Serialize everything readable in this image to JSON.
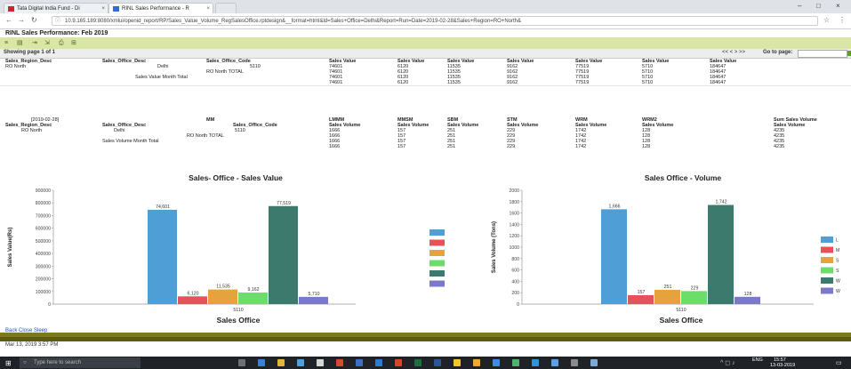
{
  "browser": {
    "tabs": [
      {
        "label": "Tata Digital India Fund - Di"
      },
      {
        "label": "RINL Sales Performance - R"
      }
    ],
    "url": "10.9.165.189:8080/xmlui/openid_report/RP/Sales_Value_Volume_RegSalesOffice.rptdesign&__format=html&ld=Sales+Office=Delhi&Report=Run=Date=2019-02-28&Sales+Region=RO+North&"
  },
  "report": {
    "title": "RINL Sales Performance: Feb 2019",
    "pager": {
      "showing": "Showing page 1 of 1",
      "nav": "<< < > >>",
      "goto": "Go to page:"
    },
    "value_section": {
      "headers": [
        "Sales_Region_Desc",
        "Sales_Office_Desc",
        "Sales_Office_Code",
        "Sales Value",
        "Sales Value",
        "Sales Value",
        "Sales Value",
        "Sales Value",
        "Sales Value",
        "Sales Value"
      ],
      "region": "RO North",
      "office": "Delhi",
      "code": "5110",
      "values": [
        "74601",
        "6120",
        "11535",
        "9162",
        "77519",
        "5710",
        "184647"
      ],
      "total_label": "RO North TOTAL",
      "month_total_label": "Sales Value Month Total"
    },
    "volume_section": {
      "period": "[2019-02-28]",
      "headers_top": [
        "",
        "",
        "MM",
        "",
        "LMMM",
        "MMSM",
        "SBM",
        "STM",
        "WRM",
        "WRM2",
        "Sum Sales Volume"
      ],
      "headers": [
        "Sales_Region_Desc",
        "Sales_Office_Desc",
        "",
        "Sales_Office_Code",
        "Sales Volume",
        "Sales Volume",
        "Sales Volume",
        "Sales Volume",
        "Sales Volume",
        "Sales Volume",
        "Sales Volume"
      ],
      "region": "RO North",
      "office": "Delhi",
      "code": "5110",
      "values": [
        "1666",
        "157",
        "251",
        "229",
        "1742",
        "128",
        "4235"
      ],
      "total_label": "RO North TOTAL",
      "month_total_label": "Sales Volume Month Total"
    },
    "back_link": "Back Close Sleep",
    "timestamp": "Mar 13, 2019 3:57 PM"
  },
  "chart_data": [
    {
      "type": "bar",
      "title": "Sales- Office - Sales Value",
      "xlabel": "Sales Office",
      "ylabel": "Sales Value(Rs)",
      "categories": [
        "5110"
      ],
      "series": [
        {
          "name": "LMMM",
          "values": [
            74601
          ]
        },
        {
          "name": "MMSM",
          "values": [
            6120
          ]
        },
        {
          "name": "SBM",
          "values": [
            11535
          ]
        },
        {
          "name": "STM",
          "values": [
            9162
          ]
        },
        {
          "name": "WRM",
          "values": [
            77519
          ]
        },
        {
          "name": "WRM2",
          "values": [
            5710
          ]
        }
      ],
      "data_labels": [
        "74,601",
        "6,120",
        "11,535",
        "9,162",
        "77,519",
        "5,710"
      ],
      "yticks": [
        "0",
        "100000",
        "200000",
        "300000",
        "400000",
        "500000",
        "600000",
        "700000",
        "800000",
        "900000"
      ],
      "ylim": [
        0,
        90000
      ],
      "legend": "right"
    },
    {
      "type": "bar",
      "title": "Sales Office - Volume",
      "xlabel": "Sales Office",
      "ylabel": "Sales Volume (Tons)",
      "categories": [
        "5110"
      ],
      "series": [
        {
          "name": "LMMM",
          "values": [
            1666
          ]
        },
        {
          "name": "MMSM",
          "values": [
            157
          ]
        },
        {
          "name": "SBM",
          "values": [
            251
          ]
        },
        {
          "name": "STM",
          "values": [
            229
          ]
        },
        {
          "name": "WRM",
          "values": [
            1742
          ]
        },
        {
          "name": "WRM2",
          "values": [
            128
          ]
        }
      ],
      "data_labels": [
        "1,666",
        "157",
        "251",
        "229",
        "1,742",
        "128"
      ],
      "yticks": [
        "0",
        "200",
        "400",
        "600",
        "800",
        "1000",
        "1200",
        "1400",
        "1600",
        "1800",
        "2000"
      ],
      "ylim": [
        0,
        2000
      ],
      "legend": "right"
    }
  ],
  "colors": {
    "LMMM": "#4f9fd6",
    "MMSM": "#e8505b",
    "SBM": "#e6a23c",
    "STM": "#6ddc6a",
    "WRM": "#3d7a6e",
    "WRM2": "#7b79c9"
  },
  "taskbar": {
    "search_placeholder": "Type here to search",
    "lang": "ENG",
    "time": "15:57",
    "date": "13-03-2019"
  }
}
